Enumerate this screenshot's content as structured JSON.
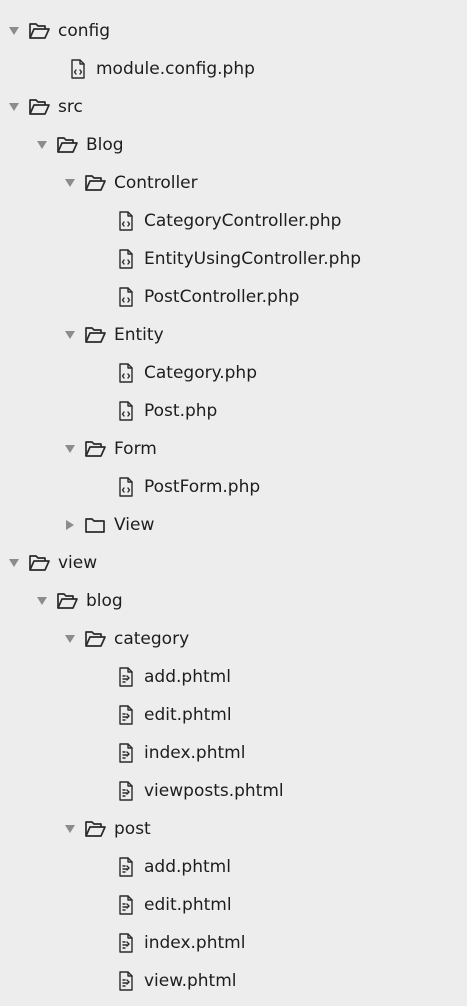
{
  "tree": [
    {
      "label": "config",
      "kind": "folder",
      "depth": 0,
      "state": "expanded"
    },
    {
      "label": "module.config.php",
      "kind": "file",
      "depth": 1,
      "ftype": "php"
    },
    {
      "label": "src",
      "kind": "folder",
      "depth": 0,
      "state": "expanded"
    },
    {
      "label": "Blog",
      "kind": "folder",
      "depth": 1,
      "state": "expanded"
    },
    {
      "label": "Controller",
      "kind": "folder",
      "depth": 2,
      "state": "expanded"
    },
    {
      "label": "CategoryController.php",
      "kind": "file",
      "depth": 3,
      "ftype": "php"
    },
    {
      "label": "EntityUsingController.php",
      "kind": "file",
      "depth": 3,
      "ftype": "php"
    },
    {
      "label": "PostController.php",
      "kind": "file",
      "depth": 3,
      "ftype": "php"
    },
    {
      "label": "Entity",
      "kind": "folder",
      "depth": 2,
      "state": "expanded"
    },
    {
      "label": "Category.php",
      "kind": "file",
      "depth": 3,
      "ftype": "php"
    },
    {
      "label": "Post.php",
      "kind": "file",
      "depth": 3,
      "ftype": "php"
    },
    {
      "label": "Form",
      "kind": "folder",
      "depth": 2,
      "state": "expanded"
    },
    {
      "label": "PostForm.php",
      "kind": "file",
      "depth": 3,
      "ftype": "php"
    },
    {
      "label": "View",
      "kind": "folder",
      "depth": 2,
      "state": "collapsed"
    },
    {
      "label": "view",
      "kind": "folder",
      "depth": 0,
      "state": "expanded"
    },
    {
      "label": "blog",
      "kind": "folder",
      "depth": 1,
      "state": "expanded"
    },
    {
      "label": "category",
      "kind": "folder",
      "depth": 2,
      "state": "expanded"
    },
    {
      "label": "add.phtml",
      "kind": "file",
      "depth": 3,
      "ftype": "phtml"
    },
    {
      "label": "edit.phtml",
      "kind": "file",
      "depth": 3,
      "ftype": "phtml"
    },
    {
      "label": "index.phtml",
      "kind": "file",
      "depth": 3,
      "ftype": "phtml"
    },
    {
      "label": "viewposts.phtml",
      "kind": "file",
      "depth": 3,
      "ftype": "phtml"
    },
    {
      "label": "post",
      "kind": "folder",
      "depth": 2,
      "state": "expanded"
    },
    {
      "label": "add.phtml",
      "kind": "file",
      "depth": 3,
      "ftype": "phtml"
    },
    {
      "label": "edit.phtml",
      "kind": "file",
      "depth": 3,
      "ftype": "phtml"
    },
    {
      "label": "index.phtml",
      "kind": "file",
      "depth": 3,
      "ftype": "phtml"
    },
    {
      "label": "view.phtml",
      "kind": "file",
      "depth": 3,
      "ftype": "phtml"
    }
  ],
  "colors": {
    "background": "#ededed",
    "text": "#1d1d1d",
    "icon": "#2b2b2b",
    "arrow": "#8c8c8c"
  }
}
